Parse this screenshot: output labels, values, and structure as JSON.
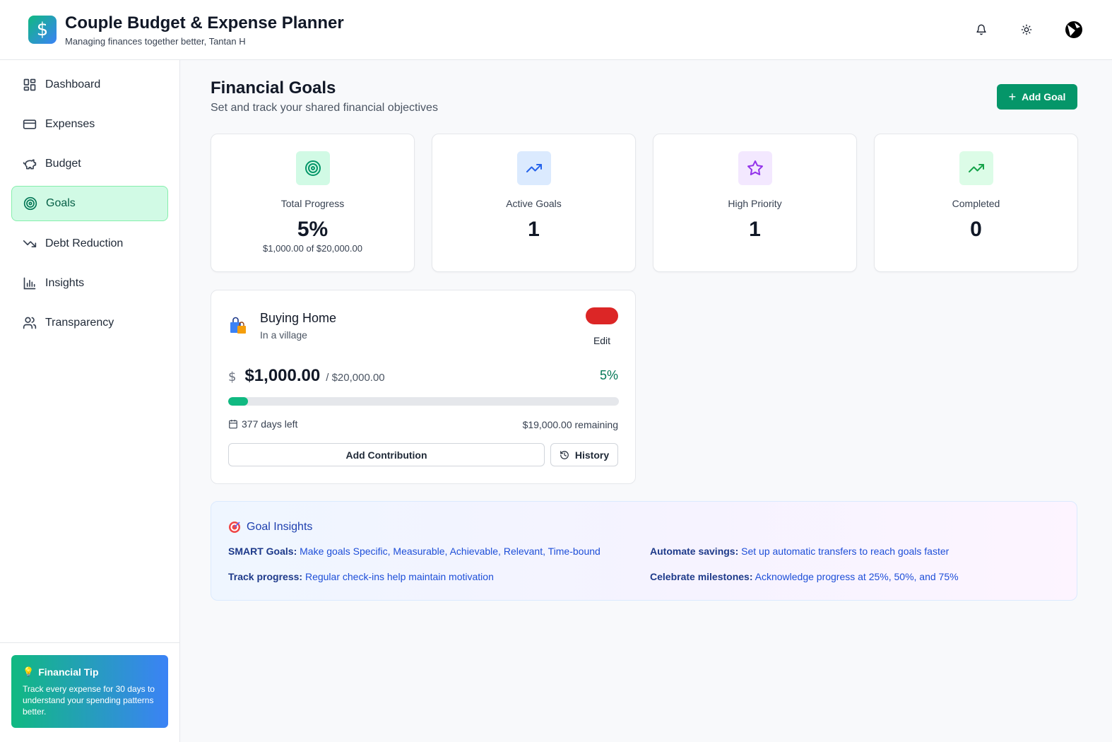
{
  "app": {
    "logo_glyph": "$",
    "title": "Couple Budget & Expense Planner",
    "subtitle": "Managing finances together better, Tantan H"
  },
  "header_actions": [
    {
      "icon": "bell-icon"
    },
    {
      "icon": "sun-icon"
    },
    {
      "icon": "avatar"
    }
  ],
  "sidebar": {
    "items": [
      {
        "label": "Dashboard",
        "icon": "dashboard-icon",
        "active": false
      },
      {
        "label": "Expenses",
        "icon": "credit-card-icon",
        "active": false
      },
      {
        "label": "Budget",
        "icon": "piggy-bank-icon",
        "active": false
      },
      {
        "label": "Goals",
        "icon": "target-icon",
        "active": true
      },
      {
        "label": "Debt Reduction",
        "icon": "trending-down-icon",
        "active": false
      },
      {
        "label": "Insights",
        "icon": "bar-chart-icon",
        "active": false
      },
      {
        "label": "Transparency",
        "icon": "users-icon",
        "active": false
      }
    ],
    "tip": {
      "icon": "lightbulb-icon",
      "title": "Financial Tip",
      "text": "Track every expense for 30 days to understand your spending patterns better."
    }
  },
  "page": {
    "title": "Financial Goals",
    "subtitle": "Set and track your shared financial objectives",
    "add_goal_label": "Add Goal"
  },
  "stats": [
    {
      "label": "Total Progress",
      "value": "5%",
      "sub": "$1,000.00 of $20,000.00",
      "icon": "target-icon",
      "icon_bg": "#d1fae5",
      "icon_color": "#059669"
    },
    {
      "label": "Active Goals",
      "value": "1",
      "sub": "",
      "icon": "trending-up-icon",
      "icon_bg": "#dbeafe",
      "icon_color": "#2563eb"
    },
    {
      "label": "High Priority",
      "value": "1",
      "sub": "",
      "icon": "star-icon",
      "icon_bg": "#f3e8ff",
      "icon_color": "#9333ea"
    },
    {
      "label": "Completed",
      "value": "0",
      "sub": "",
      "icon": "trending-up-icon",
      "icon_bg": "#dcfce7",
      "icon_color": "#16a34a"
    }
  ],
  "goal": {
    "icon": "shopping-bags-icon",
    "name": "Buying Home",
    "description": "In a village",
    "priority_color": "#dc2626",
    "edit_label": "Edit",
    "currency_symbol": "$",
    "current": "$1,000.00",
    "target": "/ $20,000.00",
    "percent_label": "5%",
    "progress_fraction": 0.05,
    "days_left": "377 days left",
    "remaining": "$19,000.00 remaining",
    "contribution_label": "Add Contribution",
    "history_label": "History"
  },
  "insights": {
    "icon": "dart-target-icon",
    "title": "Goal Insights",
    "items": [
      {
        "bold": "SMART Goals:",
        "text": " Make goals Specific, Measurable, Achievable, Relevant, Time-bound"
      },
      {
        "bold": "Automate savings:",
        "text": " Set up automatic transfers to reach goals faster"
      },
      {
        "bold": "Track progress:",
        "text": " Regular check-ins help maintain motivation"
      },
      {
        "bold": "Celebrate milestones:",
        "text": " Acknowledge progress at 25%, 50%, and 75%"
      }
    ]
  },
  "colors": {
    "accent": "#059669",
    "active_nav_bg": "#d1fae5",
    "progress": "#10b981"
  }
}
